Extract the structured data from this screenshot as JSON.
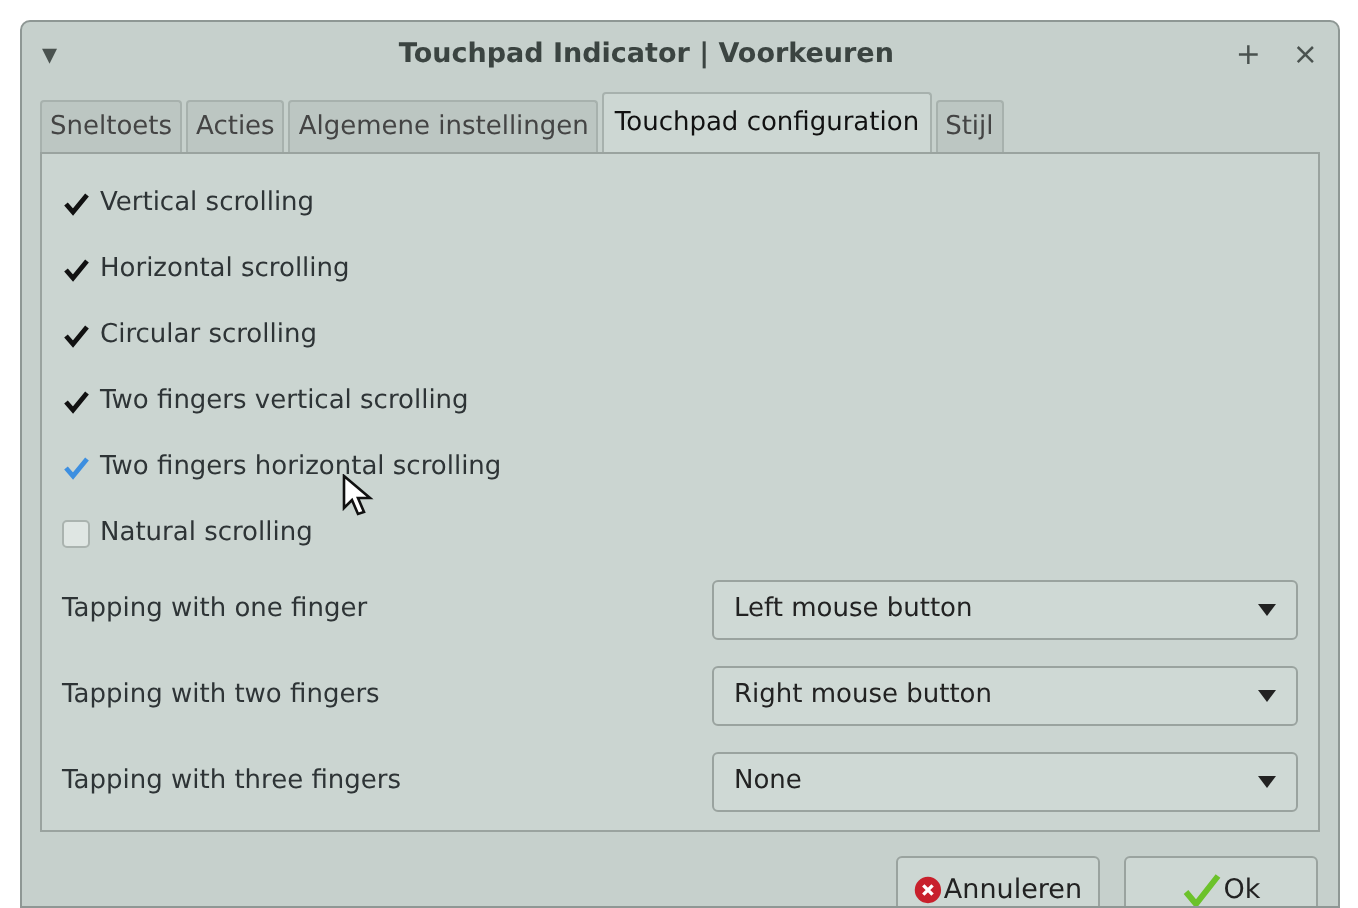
{
  "window": {
    "title": "Touchpad Indicator | Voorkeuren",
    "menu_glyph": "▾",
    "buttons": [
      "+",
      "×"
    ]
  },
  "tabs": [
    {
      "label": "Sneltoets",
      "selected": false
    },
    {
      "label": "Acties",
      "selected": false
    },
    {
      "label": "Algemene instellingen",
      "selected": false
    },
    {
      "label": "Touchpad configuration",
      "selected": true
    },
    {
      "label": "Stijl",
      "selected": false
    }
  ],
  "checkboxes": [
    {
      "label": "Vertical scrolling",
      "checked": true,
      "hovered": false
    },
    {
      "label": "Horizontal scrolling",
      "checked": true,
      "hovered": false
    },
    {
      "label": "Circular scrolling",
      "checked": true,
      "hovered": false
    },
    {
      "label": "Two fingers vertical scrolling",
      "checked": true,
      "hovered": false
    },
    {
      "label": "Two fingers horizontal scrolling",
      "checked": true,
      "hovered": true
    },
    {
      "label": "Natural scrolling",
      "checked": false,
      "hovered": false
    }
  ],
  "dropdowns": [
    {
      "label": "Tapping with one finger",
      "value": "Left mouse button"
    },
    {
      "label": "Tapping with two fingers",
      "value": "Right mouse button"
    },
    {
      "label": "Tapping with three fingers",
      "value": "None"
    }
  ],
  "footer_buttons": [
    {
      "label": "Annuleren",
      "kind": "cancel"
    },
    {
      "label": "Ok",
      "kind": "ok"
    }
  ]
}
